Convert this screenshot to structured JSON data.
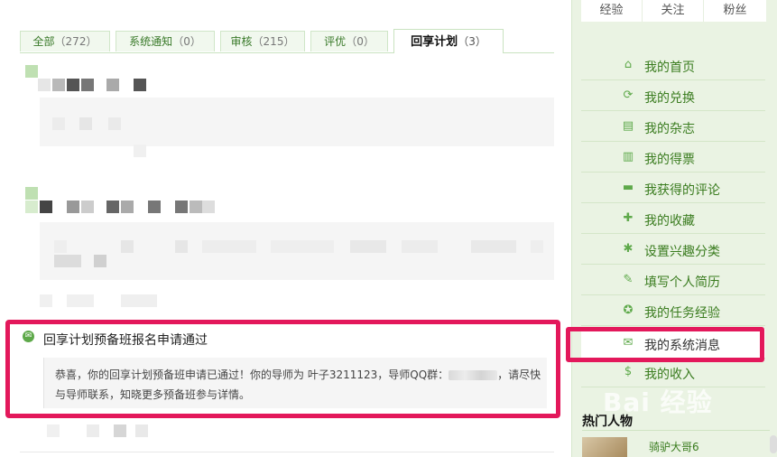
{
  "tabs": [
    {
      "label": "全部",
      "count": "（272）"
    },
    {
      "label": "系统通知",
      "count": "（0）"
    },
    {
      "label": "审核",
      "count": "（215）"
    },
    {
      "label": "评优",
      "count": "（0）"
    },
    {
      "label": "回享计划",
      "count": "（3）"
    }
  ],
  "message": {
    "title": "回享计划预备班报名申请通过",
    "body_part1": "恭喜，你的回享计划预备班申请已通过！你的导师为 叶子3211123，导师QQ群：",
    "body_part2": "，请尽快",
    "body_line2": "与导师联系，知晓更多预备班参与详情。"
  },
  "sidebar": {
    "stats": [
      "经验",
      "关注",
      "粉丝"
    ],
    "menu": [
      {
        "label": "我的首页",
        "icon": "home-icon",
        "glyph": "⌂"
      },
      {
        "label": "我的兑换",
        "icon": "exchange-icon",
        "glyph": "⟳"
      },
      {
        "label": "我的杂志",
        "icon": "magazine-icon",
        "glyph": "▤"
      },
      {
        "label": "我的得票",
        "icon": "bar-chart-icon",
        "glyph": "▥"
      },
      {
        "label": "我获得的评论",
        "icon": "comment-icon",
        "glyph": "▬"
      },
      {
        "label": "我的收藏",
        "icon": "favorite-icon",
        "glyph": "✚"
      },
      {
        "label": "设置兴趣分类",
        "icon": "gear-icon",
        "glyph": "✱"
      },
      {
        "label": "填写个人简历",
        "icon": "edit-icon",
        "glyph": "✎"
      },
      {
        "label": "我的任务经验",
        "icon": "task-icon",
        "glyph": "✪"
      },
      {
        "label": "我的系统消息",
        "icon": "envelope-icon",
        "glyph": "✉"
      },
      {
        "label": "我的收入",
        "icon": "money-icon",
        "glyph": "$"
      }
    ],
    "hot_title": "热门人物",
    "hot_person": "骑驴大哥6"
  },
  "watermark": "Bai 经验",
  "colors": {
    "accent": "#5ea94a",
    "highlight": "#e3185b",
    "sidebar_bg": "#eaf3e3",
    "link": "#3a7c1f"
  }
}
